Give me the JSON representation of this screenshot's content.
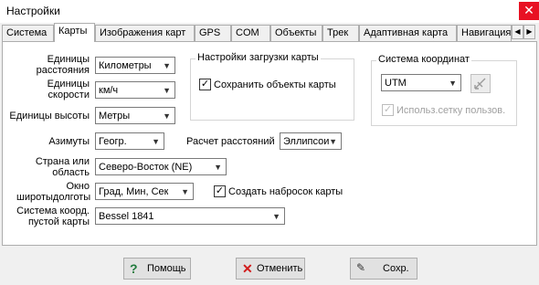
{
  "window": {
    "title": "Настройки",
    "close": "✕"
  },
  "tabs": [
    "Система",
    "Карты",
    "Изображения карт",
    "GPS",
    "COM",
    "Объекты",
    "Трек",
    "Адаптивная карта",
    "Навигация"
  ],
  "tab_active_index": 1,
  "scroll_left": "◀",
  "scroll_right": "▶",
  "form": {
    "distance_units_label": "Единицы\nрасстояния",
    "distance_units_value": "Километры",
    "speed_units_label": "Единицы\nскорости",
    "speed_units_value": "км/ч",
    "height_units_label": "Единицы высоты",
    "height_units_value": "Метры",
    "azimuth_label": "Азимуты",
    "azimuth_value": "Геогр.",
    "distance_calc_label": "Расчет расстояний",
    "distance_calc_value": "Эллипсоид",
    "region_label": "Страна или\nобласть",
    "region_value": "Северо-Восток (NE)",
    "coord_window_label": "Окно\nширотыдолготы",
    "coord_window_value": "Град, Мин, Сек",
    "sketch_checkbox_label": "Создать набросок карты",
    "sketch_checked": true,
    "empty_map_cs_label": "Система коорд.\nпустой карты",
    "empty_map_cs_value": "Bessel 1841"
  },
  "load_settings": {
    "title": "Настройки загрузки карты",
    "save_objects_label": "Сохранить объекты карты",
    "save_objects_checked": true
  },
  "coord_system": {
    "title": "Система координат",
    "value": "UTM",
    "use_grid_label": "Использ.сетку пользов.",
    "use_grid_checked": true
  },
  "buttons": {
    "help": "Помощь",
    "cancel": "Отменить",
    "save": "Сохр."
  },
  "colors": {
    "close_bg": "#e81123",
    "help_icon": "#1f7a3c",
    "cancel_icon": "#d11b1b",
    "save_icon": "#333333"
  }
}
